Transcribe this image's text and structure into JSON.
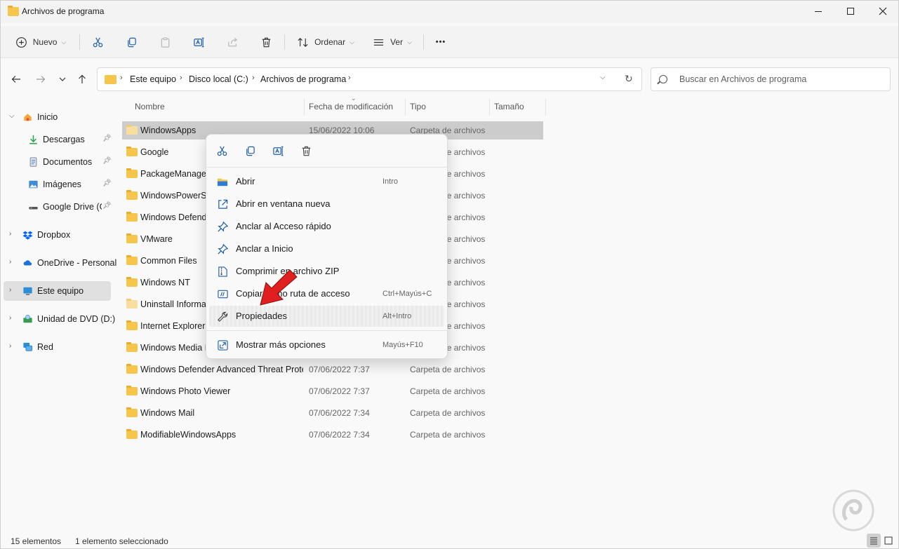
{
  "window": {
    "title": "Archivos de programa"
  },
  "toolbar": {
    "new_label": "Nuevo",
    "sort_label": "Ordenar",
    "view_label": "Ver",
    "more_label": "•••"
  },
  "address": {
    "crumbs": [
      "Este equipo",
      "Disco local (C:)",
      "Archivos de programa"
    ]
  },
  "search": {
    "placeholder": "Buscar en Archivos de programa"
  },
  "sidebar": {
    "items": [
      {
        "label": "Inicio"
      },
      {
        "label": "Descargas"
      },
      {
        "label": "Documentos"
      },
      {
        "label": "Imágenes"
      },
      {
        "label": "Google Drive (G"
      },
      {
        "label": "Dropbox"
      },
      {
        "label": "OneDrive - Personal"
      },
      {
        "label": "Este equipo"
      },
      {
        "label": "Unidad de DVD (D:)"
      },
      {
        "label": "Red"
      }
    ]
  },
  "columns": {
    "name": "Nombre",
    "date": "Fecha de modificación",
    "type": "Tipo",
    "size": "Tamaño"
  },
  "files": [
    {
      "name": "WindowsApps",
      "date": "15/06/2022 10:06",
      "type": "Carpeta de archivos"
    },
    {
      "name": "Google",
      "date": "",
      "type": "Carpeta de archivos"
    },
    {
      "name": "PackageManagement",
      "date": "",
      "type": "Carpeta de archivos"
    },
    {
      "name": "WindowsPowerShell",
      "date": "",
      "type": "Carpeta de archivos"
    },
    {
      "name": "Windows Defender",
      "date": "",
      "type": "Carpeta de archivos"
    },
    {
      "name": "VMware",
      "date": "",
      "type": "Carpeta de archivos"
    },
    {
      "name": "Common Files",
      "date": "",
      "type": "Carpeta de archivos"
    },
    {
      "name": "Windows NT",
      "date": "",
      "type": "Carpeta de archivos"
    },
    {
      "name": "Uninstall Information",
      "date": "",
      "type": "Carpeta de archivos"
    },
    {
      "name": "Internet Explorer",
      "date": "",
      "type": "Carpeta de archivos"
    },
    {
      "name": "Windows Media Player",
      "date": "",
      "type": "Carpeta de archivos"
    },
    {
      "name": "Windows Defender Advanced Threat Protection",
      "date": "07/06/2022 7:37",
      "type": "Carpeta de archivos"
    },
    {
      "name": "Windows Photo Viewer",
      "date": "07/06/2022 7:37",
      "type": "Carpeta de archivos"
    },
    {
      "name": "Windows Mail",
      "date": "07/06/2022 7:34",
      "type": "Carpeta de archivos"
    },
    {
      "name": "ModifiableWindowsApps",
      "date": "07/06/2022 7:34",
      "type": "Carpeta de archivos"
    }
  ],
  "context_menu": {
    "items": [
      {
        "label": "Abrir",
        "shortcut": "Intro",
        "icon": "open-folder-icon"
      },
      {
        "label": "Abrir en ventana nueva",
        "shortcut": "",
        "icon": "open-new-window-icon"
      },
      {
        "label": "Anclar al Acceso rápido",
        "shortcut": "",
        "icon": "pin-icon"
      },
      {
        "label": "Anclar a Inicio",
        "shortcut": "",
        "icon": "pin-start-icon"
      },
      {
        "label": "Comprimir en archivo ZIP",
        "shortcut": "",
        "icon": "zip-icon"
      },
      {
        "label": "Copiar como ruta de acceso",
        "shortcut": "Ctrl+Mayús+C",
        "icon": "copy-path-icon"
      },
      {
        "label": "Propiedades",
        "shortcut": "Alt+Intro",
        "icon": "wrench-icon"
      },
      {
        "label": "Mostrar más opciones",
        "shortcut": "Mayús+F10",
        "icon": "more-options-icon"
      }
    ]
  },
  "status": {
    "count": "15 elementos",
    "selected": "1 elemento seleccionado"
  },
  "colors": {
    "folder": "#f5c54c",
    "accent": "#1f5fa8",
    "arrow": "#e02020"
  }
}
